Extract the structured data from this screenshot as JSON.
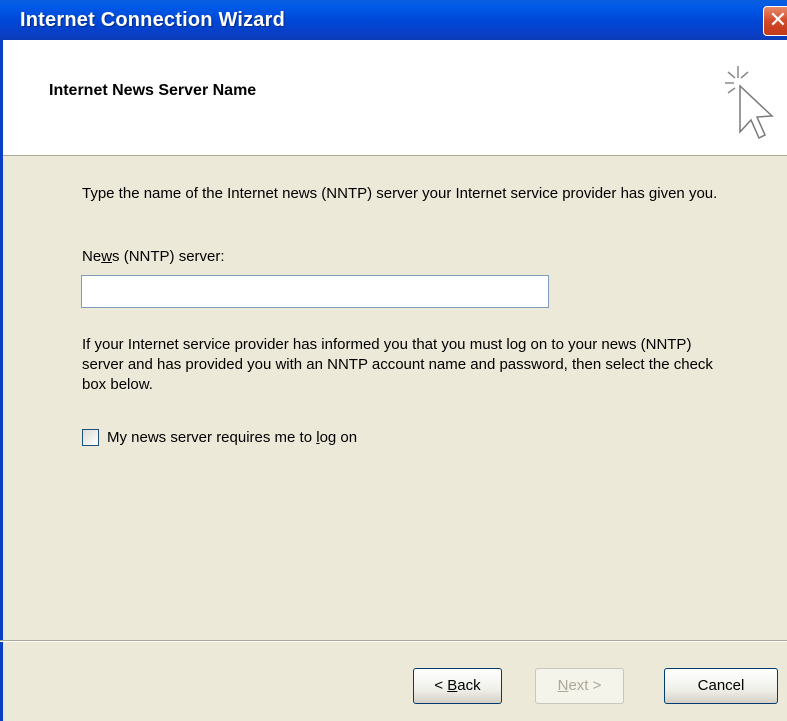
{
  "window": {
    "title": "Internet Connection Wizard",
    "close_label": "✕"
  },
  "header": {
    "title": "Internet News Server Name",
    "icon": "wizard-cursor-icon"
  },
  "content": {
    "intro": "Type the name of the Internet news (NNTP) server your Internet service provider has given you.",
    "field_label_pre": "Ne",
    "field_label_u": "w",
    "field_label_post": "s (NNTP) server:",
    "server_value": "",
    "info": "If your Internet service provider has informed you that you must log on to your news (NNTP) server and has provided you with an NNTP account name and password, then select the check box below.",
    "checkbox_label_pre": "My news server requires me to ",
    "checkbox_label_u": "l",
    "checkbox_label_post": "og on",
    "checkbox_checked": false
  },
  "buttons": {
    "back_pre": "< ",
    "back_u": "B",
    "back_post": "ack",
    "next_u": "N",
    "next_post": "ext >",
    "cancel": "Cancel"
  },
  "colors": {
    "titlebar": "#0a3ec5",
    "dialog_bg": "#ece9d8",
    "header_bg": "#ffffff"
  }
}
